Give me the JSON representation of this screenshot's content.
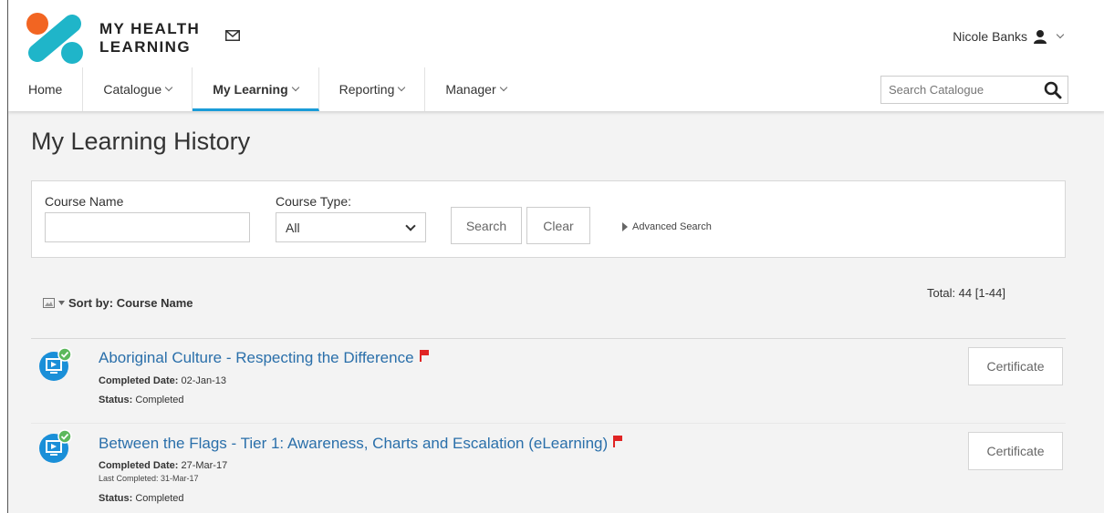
{
  "header": {
    "brand_line1": "MY HEALTH",
    "brand_line2": "LEARNING",
    "user_name": "Nicole Banks",
    "icons": [
      "logo",
      "mail-icon",
      "user-icon",
      "chevron-down-icon",
      "search-icon"
    ]
  },
  "nav": {
    "items": [
      {
        "label": "Home",
        "has_menu": false
      },
      {
        "label": "Catalogue",
        "has_menu": true
      },
      {
        "label": "My Learning",
        "has_menu": true,
        "active": true
      },
      {
        "label": "Reporting",
        "has_menu": true
      },
      {
        "label": "Manager",
        "has_menu": true
      }
    ],
    "search_placeholder": "Search Catalogue"
  },
  "page": {
    "title": "My Learning History"
  },
  "filters": {
    "course_name_label": "Course Name",
    "course_name_value": "",
    "course_type_label": "Course Type:",
    "course_type_value": "All",
    "search_button": "Search",
    "clear_button": "Clear",
    "advanced_search": "Advanced Search"
  },
  "list": {
    "sort_label": "Sort by: Course Name",
    "total": "Total: 44 [1-44]",
    "items": [
      {
        "title": "Aboriginal Culture - Respecting the Difference",
        "completed_label": "Completed Date:",
        "completed_date": "02-Jan-13",
        "last_completed": "",
        "status_label": "Status:",
        "status": "Completed",
        "button": "Certificate"
      },
      {
        "title": "Between the Flags - Tier 1: Awareness, Charts and Escalation (eLearning)",
        "completed_label": "Completed Date:",
        "completed_date": "27-Mar-17",
        "last_completed": "Last Completed: 31-Mar-17",
        "status_label": "Status:",
        "status": "Completed",
        "button": "Certificate"
      }
    ]
  },
  "colors": {
    "accent": "#1a9cd8",
    "link": "#2a6faa",
    "logo_orange": "#f26522",
    "logo_teal": "#1fb5c9",
    "flag_red": "#e02424",
    "check_green": "#5cb85c",
    "page_bg": "#f3f3f3"
  }
}
